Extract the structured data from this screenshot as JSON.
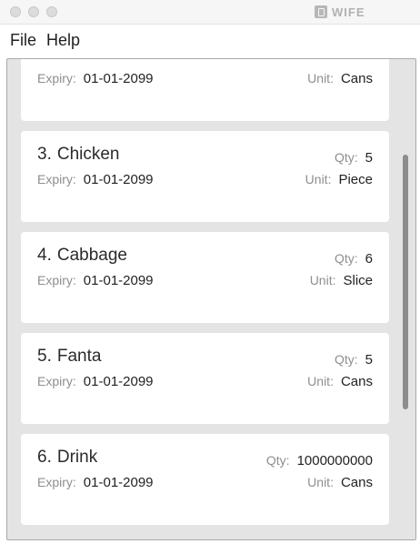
{
  "app": {
    "title": "WIFE"
  },
  "menu": {
    "file": "File",
    "help": "Help"
  },
  "labels": {
    "expiry": "Expiry:",
    "qty": "Qty:",
    "unit": "Unit:"
  },
  "items": [
    {
      "index": "",
      "name": "",
      "expiry": "01-01-2099",
      "qty": "",
      "unit": "Cans"
    },
    {
      "index": "3.",
      "name": "Chicken",
      "expiry": "01-01-2099",
      "qty": "5",
      "unit": "Piece"
    },
    {
      "index": "4.",
      "name": "Cabbage",
      "expiry": "01-01-2099",
      "qty": "6",
      "unit": "Slice"
    },
    {
      "index": "5.",
      "name": "Fanta",
      "expiry": "01-01-2099",
      "qty": "5",
      "unit": "Cans"
    },
    {
      "index": "6.",
      "name": "Drink",
      "expiry": "01-01-2099",
      "qty": "1000000000",
      "unit": "Cans"
    }
  ]
}
